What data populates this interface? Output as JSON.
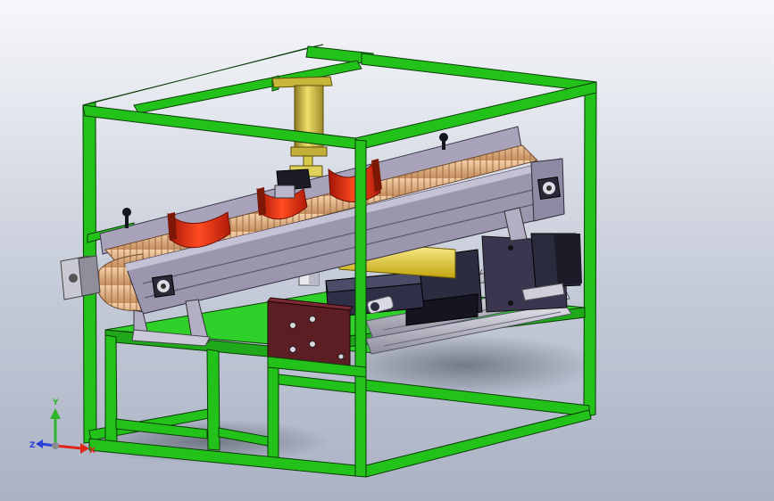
{
  "view": {
    "background_top": "#f7f8fb",
    "background_bottom": "#aab2c4"
  },
  "colors": {
    "frame_green": "#22c21a",
    "frame_outline": "#0b3d08",
    "base_plate": "#2fd02a",
    "conveyor_metal": "#9b96ad",
    "belt_tan": "#e2b58a",
    "cradle_red": "#e0280c",
    "cylinder_yellow": "#d6c23c",
    "actuator_yellow": "#f2e12a",
    "motor_dark": "#25263a",
    "bracket_maroon": "#5c1e23"
  },
  "components": {
    "cradles": [
      {
        "name": "cradle-1"
      },
      {
        "name": "cradle-2"
      },
      {
        "name": "cradle-3"
      }
    ],
    "icons": [
      "view-triad-icon",
      "knob-icon",
      "bearing-icon",
      "motor-icon",
      "cylinder-icon"
    ]
  },
  "triad": {
    "x_label": "X",
    "y_label": "Y",
    "z_label": "Z",
    "x_color": "#e1261c",
    "y_color": "#2fb52c",
    "z_color": "#2a3fd6"
  }
}
